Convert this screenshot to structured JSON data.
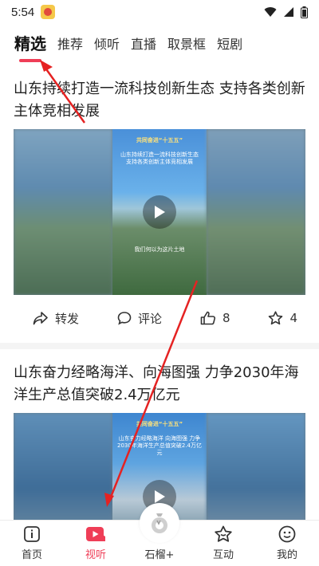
{
  "status": {
    "time": "5:54"
  },
  "tabs": [
    {
      "label": "精选"
    },
    {
      "label": "推荐"
    },
    {
      "label": "倾听"
    },
    {
      "label": "直播"
    },
    {
      "label": "取景框"
    },
    {
      "label": "短剧"
    }
  ],
  "cards": [
    {
      "title": "山东持续打造一流科技创新生态 支持各类创新主体竞相发展",
      "overlay_top": "共同奋进“十五五”",
      "overlay_mid": "山东持续打造一流科技创新生态 支持各类创新主体竞相发展",
      "overlay_bottom": "我们何以为这片土地",
      "actions": {
        "share": "转发",
        "comment": "评论",
        "likes": "8",
        "favorites": "4"
      }
    },
    {
      "title": "山东奋力经略海洋、向海图强 力争2030年海洋生产总值突破2.4万亿元",
      "overlay_top": "共同奋进“十五五”",
      "overlay_mid": "山东奋力经略海洋 向海图强 力争2030年海洋生产总值突破2.4万亿元"
    }
  ],
  "bottom_nav": [
    {
      "label": "首页",
      "icon": "home-icon"
    },
    {
      "label": "视听",
      "icon": "video-icon"
    },
    {
      "label": "石榴+",
      "icon": "pomegranate-icon"
    },
    {
      "label": "互动",
      "icon": "interact-icon"
    },
    {
      "label": "我的",
      "icon": "profile-icon"
    }
  ],
  "colors": {
    "accent": "#ef3e57",
    "annotation": "#e52222"
  }
}
